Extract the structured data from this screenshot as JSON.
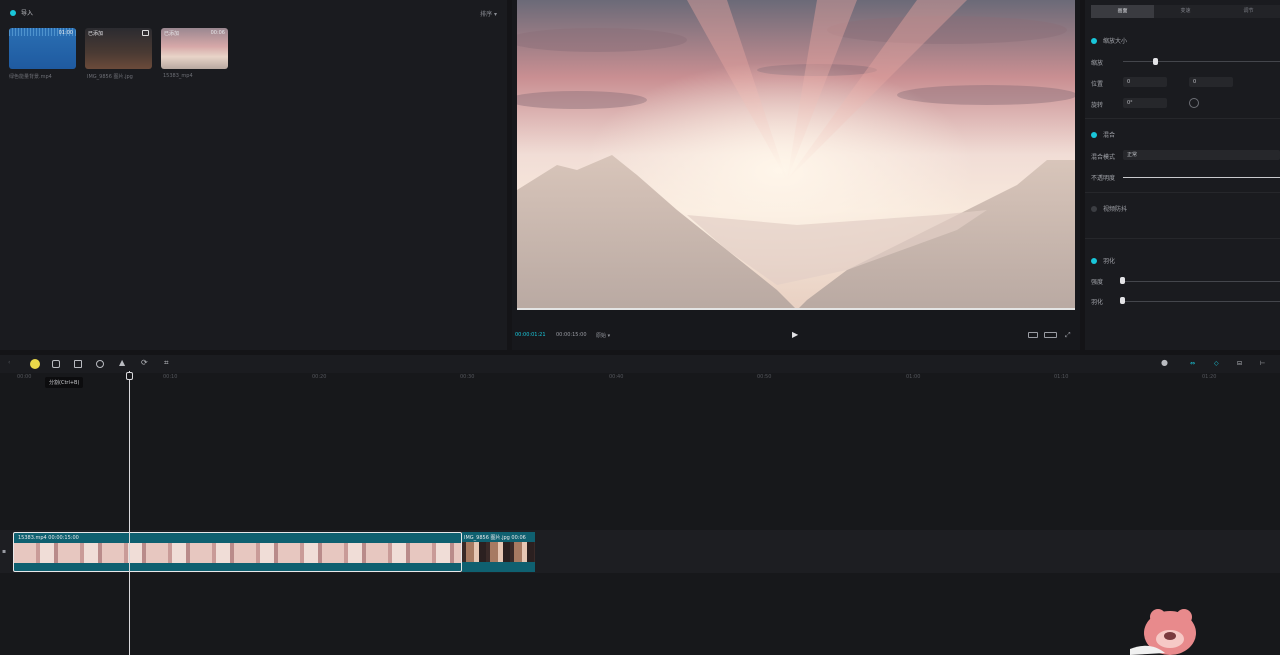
{
  "media": {
    "import_label": "导入",
    "sort_label": "排序",
    "items": [
      {
        "name": "绿色能量背景.mp4",
        "duration": "01:00",
        "tag": ""
      },
      {
        "name": "IMG_9856 图片.jpg",
        "duration": "",
        "tag": "已添加"
      },
      {
        "name": "15383_mp4",
        "duration": "00:06",
        "tag": "已添加"
      }
    ]
  },
  "player": {
    "current_time": "00:00:01:21",
    "total_time": "00:00:15:00",
    "quality": "原始"
  },
  "inspector": {
    "tabs": [
      "画面",
      "变速",
      "调节"
    ],
    "section_basic": "缩放大小",
    "scale_label": "缩放",
    "position_label": "位置",
    "pos_x": "0",
    "pos_y": "0",
    "rotation_label": "旋转",
    "rotation_value": "0°",
    "section_blend": "混合",
    "blend_mode_label": "混合模式",
    "blend_mode_value": "正常",
    "opacity_label": "不透明度",
    "section_stabilize": "视频防抖",
    "section_edge": "羽化",
    "edge1": "强度",
    "edge2": "羽化"
  },
  "timeline": {
    "tooltip": "分割(Ctrl+B)",
    "ticks": [
      "00:00",
      "00:10",
      "00:20",
      "00:30",
      "00:40",
      "00:50",
      "01:00",
      "01:10",
      "01:20"
    ],
    "clip1_label": "15383.mp4   00:00:15:00",
    "clip2_label": "IMG_9856 图片.jpg   00:06"
  },
  "colors": {
    "accent": "#19c6d9",
    "clip": "#0f6070"
  }
}
